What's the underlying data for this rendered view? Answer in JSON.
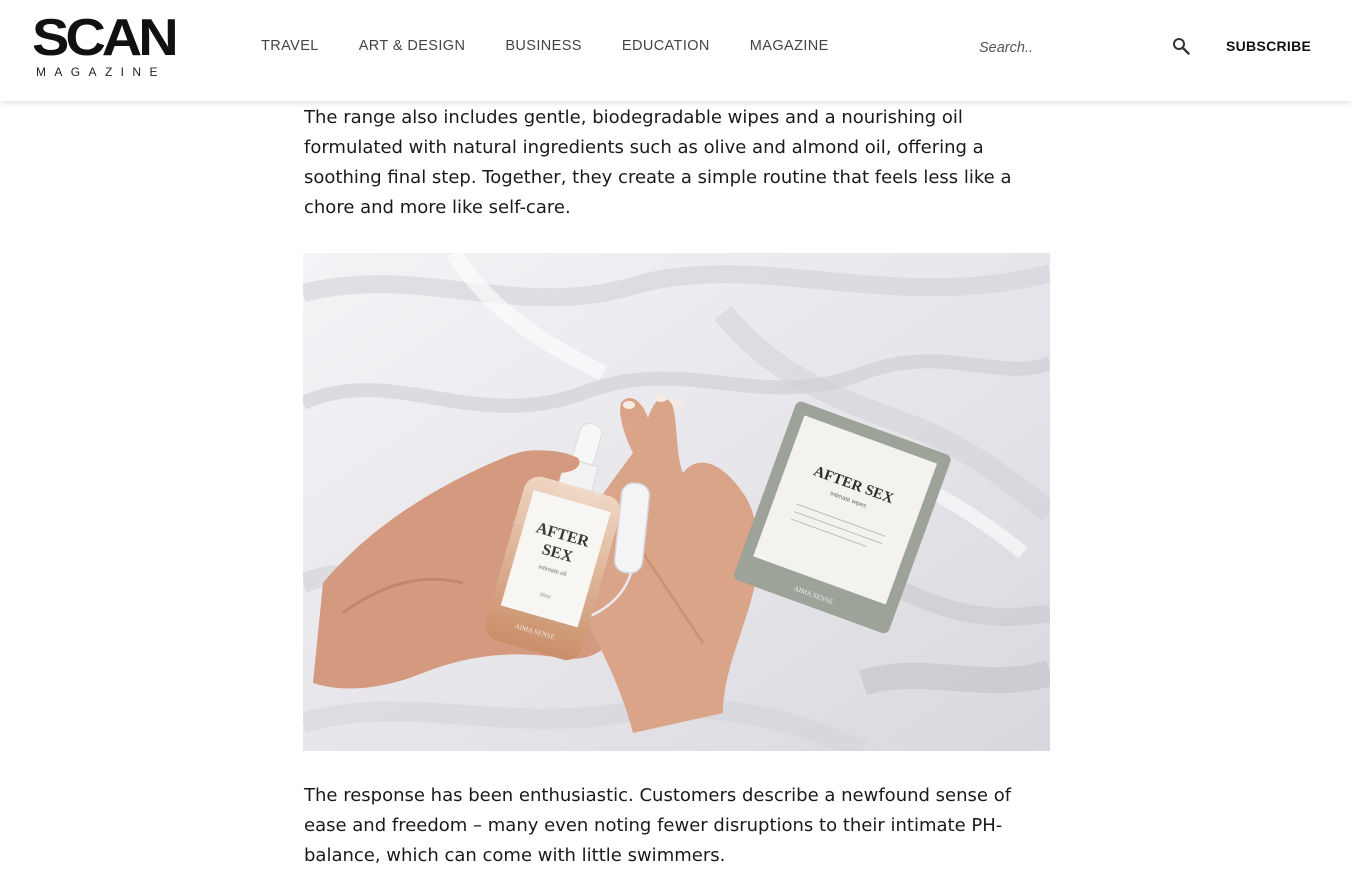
{
  "header": {
    "logo": {
      "name": "SCAN",
      "tagline": "MAGAZINE"
    },
    "nav": [
      {
        "label": "TRAVEL"
      },
      {
        "label": "ART & DESIGN"
      },
      {
        "label": "BUSINESS"
      },
      {
        "label": "EDUCATION"
      },
      {
        "label": "MAGAZINE"
      }
    ],
    "search": {
      "placeholder": "Search..",
      "value": "",
      "icon": "search-icon"
    },
    "subscribe_label": "SUBSCRIBE"
  },
  "article": {
    "paragraphs": [
      "The range also includes gentle, biodegradable wipes and a nourishing oil formulated with natural ingredients such as olive and almond oil, offering a soothing final step. Together, they create a simple routine that feels less like a chore and more like self-care.",
      "The response has been enthusiastic. Customers describe a newfound sense of ease and freedom – many even noting fewer disruptions to their intimate PH-balance, which can come with little swimmers."
    ],
    "image": {
      "products": {
        "bottle": {
          "title_line1": "AFTER",
          "title_line2": "SEX",
          "subtitle": "intimate oil",
          "volume": "30ml",
          "brand": "AIMA SENSE"
        },
        "wipe": {
          "title": "AFTER SEX",
          "subtitle": "intimate wipes",
          "brand": "AIMA SENSE"
        }
      }
    }
  },
  "colors": {
    "text": "#1a1a1a",
    "nav": "#444444",
    "header_bg": "#ffffff"
  }
}
